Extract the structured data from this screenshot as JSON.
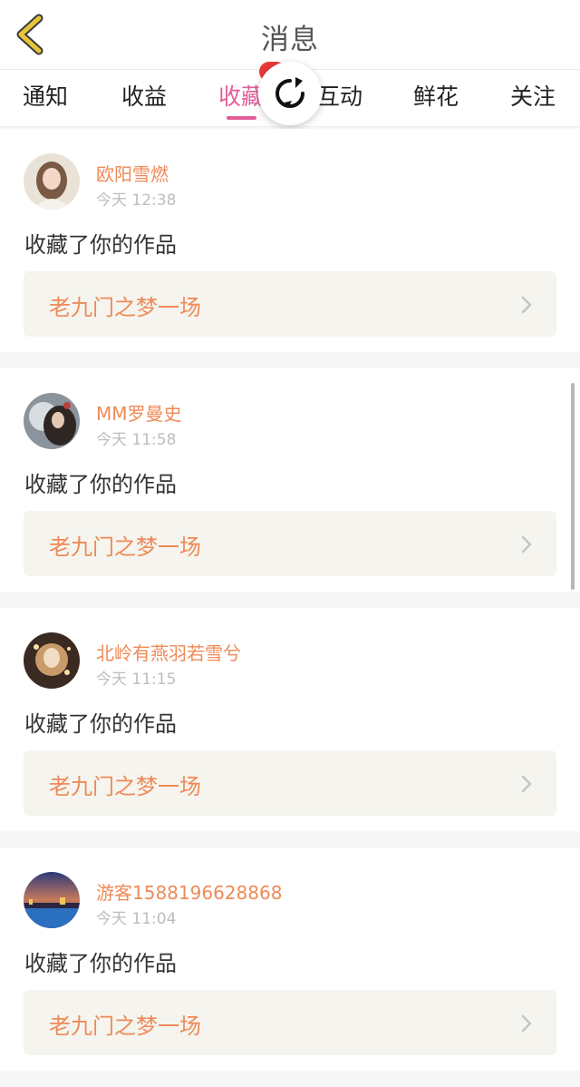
{
  "header": {
    "title": "消息",
    "back_icon": "chevron-left-icon"
  },
  "tabs": [
    {
      "label": "通知",
      "active": false
    },
    {
      "label": "收益",
      "active": false
    },
    {
      "label": "收藏",
      "active": true
    },
    {
      "label": "互动",
      "active": false
    },
    {
      "label": "鲜花",
      "active": false
    },
    {
      "label": "关注",
      "active": false
    }
  ],
  "refresh": {
    "icon": "refresh-icon"
  },
  "messages": [
    {
      "username": "欧阳雪燃",
      "time": "今天 12:38",
      "action": "收藏了你的作品",
      "work": "老九门之梦一场"
    },
    {
      "username": "MM罗曼史",
      "time": "今天 11:58",
      "action": "收藏了你的作品",
      "work": "老九门之梦一场"
    },
    {
      "username": "北岭有燕羽若雪兮",
      "time": "今天 11:15",
      "action": "收藏了你的作品",
      "work": "老九门之梦一场"
    },
    {
      "username": "游客1588196628868",
      "time": "今天 11:04",
      "action": "收藏了你的作品",
      "work": "老九门之梦一场"
    }
  ],
  "colors": {
    "accent": "#e35d9a",
    "username": "#ee8a57",
    "badge": "#e73a3a",
    "back_icon": "#d4aa2a"
  }
}
